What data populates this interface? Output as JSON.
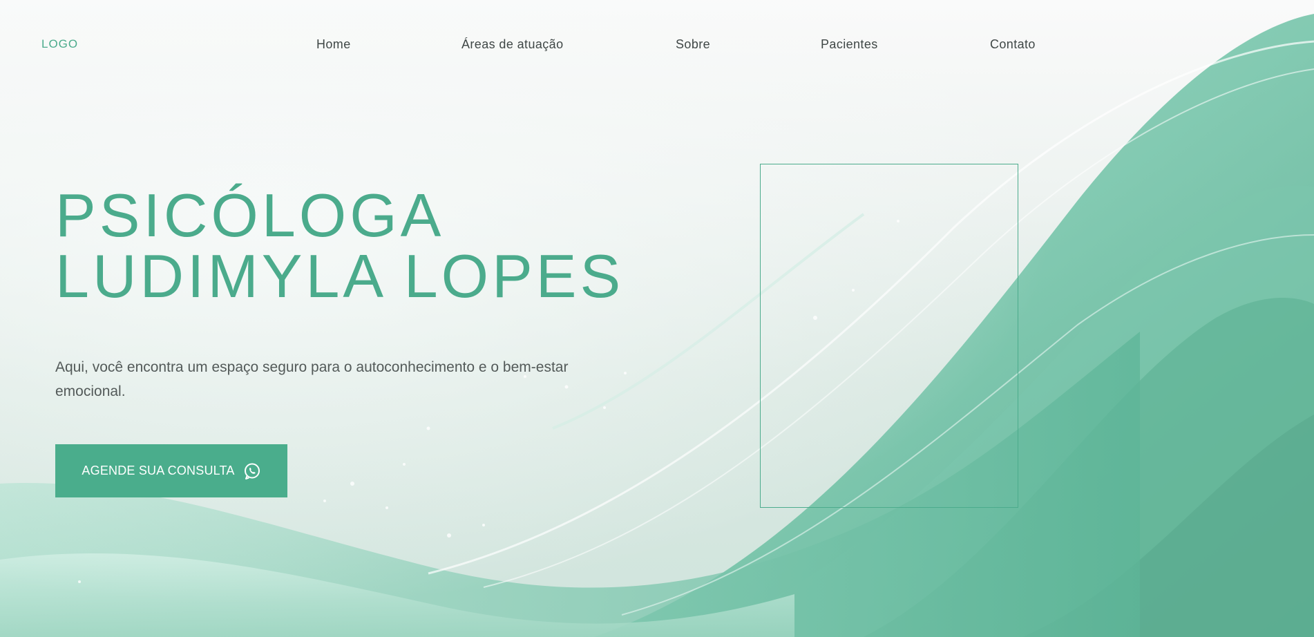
{
  "nav": {
    "logo": "LOGO",
    "items": [
      {
        "label": "Home"
      },
      {
        "label": "Áreas de atuação"
      },
      {
        "label": "Sobre"
      },
      {
        "label": "Pacientes"
      },
      {
        "label": "Contato"
      }
    ]
  },
  "hero": {
    "title_line1": "PSICÓLOGA",
    "title_line2": "LUDIMYLA LOPES",
    "subtitle": "Aqui, você encontra um espaço seguro para o autoconhecimento e o bem-estar emocional.",
    "cta_label": "AGENDE SUA CONSULTA",
    "cta_icon": "whatsapp-icon"
  },
  "colors": {
    "accent": "#4bab8c",
    "button": "#4aad8c",
    "nav_text": "#3f4746",
    "body_text": "#535a59"
  }
}
